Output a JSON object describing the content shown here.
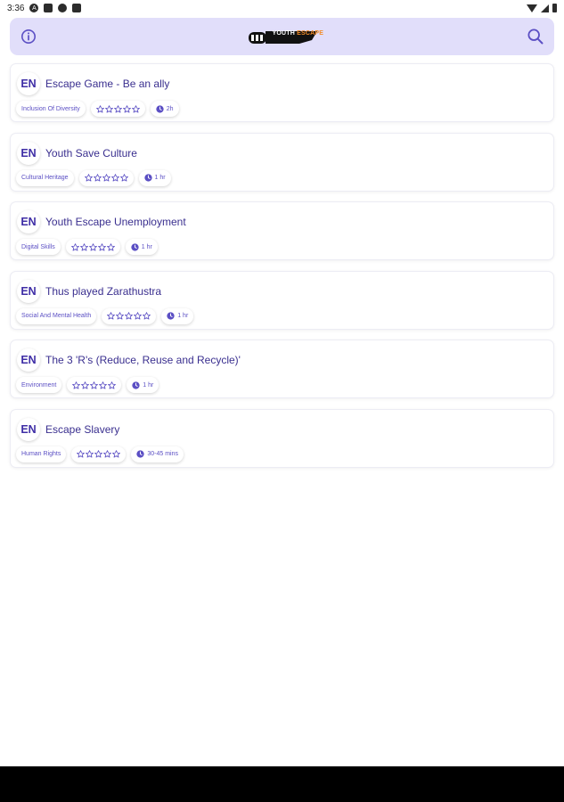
{
  "status_bar": {
    "time": "3:36"
  },
  "header": {
    "logo_text_part1": "YOUTH",
    "logo_text_part2": "ESCAPE",
    "info_icon": "info-icon",
    "search_icon": "search-icon"
  },
  "colors": {
    "accent": "#5b4fc4",
    "header_bg": "#e1defa",
    "logo_orange": "#f28c28"
  },
  "games": [
    {
      "lang": "EN",
      "title": "Escape Game - Be an ally",
      "category": "Inclusion Of Diversity",
      "duration": "2h",
      "rating": 0
    },
    {
      "lang": "EN",
      "title": "Youth Save Culture",
      "category": "Cultural Heritage",
      "duration": "1 hr",
      "rating": 0
    },
    {
      "lang": "EN",
      "title": "Youth Escape Unemployment",
      "category": "Digital Skills",
      "duration": "1 hr",
      "rating": 0
    },
    {
      "lang": "EN",
      "title": "Thus played Zarathustra",
      "category": "Social And Mental Health",
      "duration": "1 hr",
      "rating": 0
    },
    {
      "lang": "EN",
      "title": "The 3 'R's (Reduce, Reuse and Recycle)'",
      "category": "Environment",
      "duration": "1 hr",
      "rating": 0
    },
    {
      "lang": "EN",
      "title": "Escape Slavery",
      "category": "Human Rights",
      "duration": "30-45 mins",
      "rating": 0
    }
  ]
}
